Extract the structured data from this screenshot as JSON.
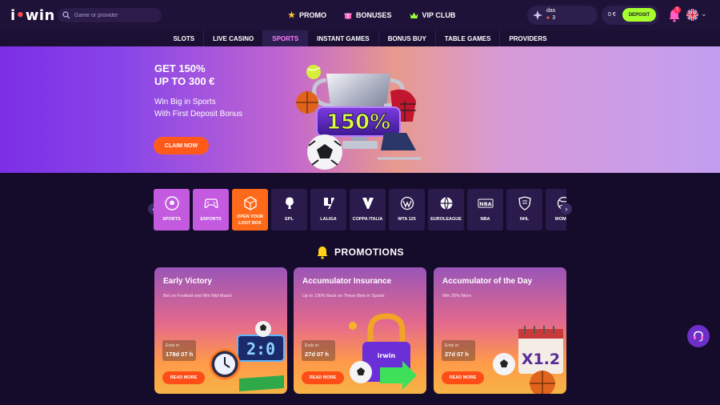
{
  "header": {
    "logo": {
      "text_a": "i",
      "text_b": "win",
      "dot": "•"
    },
    "search": {
      "placeholder": "Game or provider"
    },
    "nav": [
      {
        "label": "PROMO",
        "icon": "star-icon"
      },
      {
        "label": "BONUSES",
        "icon": "gift-icon"
      },
      {
        "label": "VIP CLUB",
        "icon": "crown-icon"
      }
    ],
    "user": {
      "name": "das",
      "level": "3"
    },
    "balance": {
      "amount": "0 €"
    },
    "deposit_label": "DEPOSIT",
    "notifications_count": "1",
    "language": "English (UK flag)"
  },
  "categories": [
    {
      "label": "SLOTS",
      "active": false
    },
    {
      "label": "LIVE CASINO",
      "active": false
    },
    {
      "label": "SPORTS",
      "active": true
    },
    {
      "label": "INSTANT GAMES",
      "active": false
    },
    {
      "label": "BONUS BUY",
      "active": false
    },
    {
      "label": "TABLE GAMES",
      "active": false
    },
    {
      "label": "PROVIDERS",
      "active": false
    }
  ],
  "hero": {
    "title_line1": "GET 150%",
    "title_line2": "UP TO 300 €",
    "sub_line1": "Win Big in Sports",
    "sub_line2": "With First Deposit Bonus",
    "cta": "CLAIM NOW",
    "badge": "150%"
  },
  "sports_tiles": [
    {
      "label": "SPORTS",
      "icon": "soccer-ball-icon",
      "style": "pink"
    },
    {
      "label": "ESPORTS",
      "icon": "gamepad-icon",
      "style": "pink"
    },
    {
      "label": "OPEN YOUR LOOT BOX",
      "icon": "loot-box-icon",
      "style": "orange"
    },
    {
      "label": "EPL",
      "icon": "epl-lion-icon",
      "style": "dark"
    },
    {
      "label": "LALIGA",
      "icon": "laliga-icon",
      "style": "dark"
    },
    {
      "label": "COPPA ITALIA",
      "icon": "coppa-italia-icon",
      "style": "dark"
    },
    {
      "label": "WTA 125",
      "icon": "wta-icon",
      "style": "dark"
    },
    {
      "label": "EUROLEAGUE",
      "icon": "euroleague-icon",
      "style": "dark"
    },
    {
      "label": "NBA",
      "icon": "nba-icon",
      "style": "dark"
    },
    {
      "label": "NHL",
      "icon": "nhl-icon",
      "style": "dark"
    },
    {
      "label": "WOMEN",
      "icon": "women-icon",
      "style": "dark"
    }
  ],
  "nba_logo_text": "NBA",
  "promotions": {
    "title": "PROMOTIONS",
    "cards": [
      {
        "title": "Early Victory",
        "subtitle": "Bet on Football and Win Mid-Match",
        "ends_label": "Ends in:",
        "ends_value": "178d  07 h",
        "cta": "READ MORE",
        "art_text": "2:0"
      },
      {
        "title": "Accumulator Insurance",
        "subtitle": "Up to 100% Back on These Bets in Sports",
        "ends_label": "Ends in:",
        "ends_value": "27d  07 h",
        "cta": "READ MORE",
        "art_text": "irwin"
      },
      {
        "title": "Accumulator of the Day",
        "subtitle": "Win 20% More",
        "ends_label": "Ends in:",
        "ends_value": "27d  07 h",
        "cta": "READ MORE",
        "art_text": "X1.2"
      }
    ]
  },
  "colors": {
    "accent_green": "#a6ff2c",
    "accent_orange": "#ff5a1a",
    "active_pink": "#ff7dff",
    "background": "#150c2c"
  }
}
